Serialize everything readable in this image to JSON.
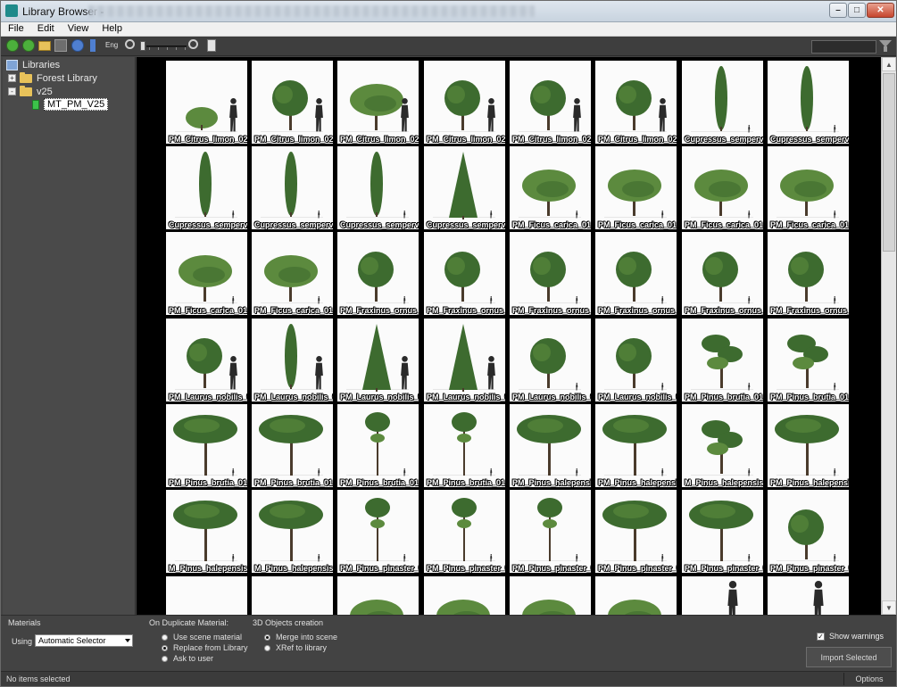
{
  "window": {
    "title": "Library Browser -",
    "icon": "app-icon",
    "controls": [
      "minimize",
      "maximize",
      "close"
    ]
  },
  "menu": [
    "File",
    "Edit",
    "View",
    "Help"
  ],
  "toolbar": {
    "icons": [
      "back-icon",
      "forward-icon",
      "open-folder-icon",
      "save-icon",
      "refresh-icon",
      "sort-icon",
      "zoom-out-icon",
      "zoom-in-icon",
      "checklist-icon"
    ],
    "zoom_slider_label": "thumbnail-size"
  },
  "tree": {
    "items": [
      {
        "label": "Libraries",
        "icon": "library-icon",
        "level": 0,
        "expander": ""
      },
      {
        "label": "Forest Library",
        "icon": "folder-icon",
        "level": 1,
        "expander": "+"
      },
      {
        "label": "v25",
        "icon": "folder-open-icon",
        "level": 1,
        "expander": "-"
      },
      {
        "label": "MT_PM_V25",
        "icon": "material-icon",
        "level": 2,
        "expander": "",
        "selected": true
      }
    ]
  },
  "grid": {
    "rows": [
      [
        "PM_Citrus_limon_02",
        "PM_Citrus_limon_02",
        "PM_Citrus_limon_02",
        "PM_Citrus_limon_02",
        "PM_Citrus_limon_02",
        "PM_Citrus_limon_02",
        "Cupressus_sempervire",
        "Cupressus_sempervire"
      ],
      [
        "Cupressus_sempervire",
        "Cupressus_sempervire",
        "Cupressus_sempervire",
        "Cupressus_sempervire",
        "PM_Ficus_carica_01",
        "PM_Ficus_carica_01",
        "PM_Ficus_carica_01",
        "PM_Ficus_carica_01"
      ],
      [
        "PM_Ficus_carica_01",
        "PM_Ficus_carica_01",
        "PM_Fraxinus_ornus_0",
        "PM_Fraxinus_ornus_0",
        "PM_Fraxinus_ornus_0",
        "PM_Fraxinus_ornus_0",
        "PM_Fraxinus_ornus_0",
        "PM_Fraxinus_ornus_0"
      ],
      [
        "PM_Laurus_nobilis_0",
        "PM_Laurus_nobilis_0",
        "PM_Laurus_nobilis_0",
        "PM_Laurus_nobilis_0",
        "PM_Laurus_nobilis_0",
        "PM_Laurus_nobilis_0",
        "PM_Pinus_brutia_01",
        "PM_Pinus_brutia_01"
      ],
      [
        "PM_Pinus_brutia_01",
        "PM_Pinus_brutia_01",
        "PM_Pinus_brutia_01",
        "PM_Pinus_brutia_01",
        "PM_Pinus_halepensis",
        "PM_Pinus_halepensis",
        "M_Pinus_halepensis",
        "PM_Pinus_halepensis"
      ],
      [
        "M_Pinus_halepensis",
        "M_Pinus_halepensis",
        "PM_Pinus_pinaster_0",
        "PM_Pinus_pinaster_0",
        "PM_Pinus_pinaster_0",
        "PM_Pinus_pinaster_0",
        "PM_Pinus_pinaster_0",
        "PM_Pinus_pinaster_0"
      ],
      [
        "",
        "",
        "",
        "",
        "",
        "",
        "",
        ""
      ]
    ],
    "shapes": [
      [
        "bush",
        "round",
        "wide",
        "round",
        "round",
        "round",
        "columnar",
        "columnar"
      ],
      [
        "columnar",
        "columnar",
        "columnar",
        "conifer",
        "wide",
        "wide",
        "wide",
        "wide"
      ],
      [
        "wide",
        "wide",
        "round",
        "round",
        "round",
        "round",
        "round",
        "round"
      ],
      [
        "round",
        "columnar",
        "conifer",
        "conifer",
        "round",
        "round",
        "pine",
        "pine"
      ],
      [
        "umbrella",
        "umbrella",
        "tallpine",
        "tallpine",
        "umbrella",
        "umbrella",
        "pine",
        "umbrella"
      ],
      [
        "umbrella",
        "umbrella",
        "tallpine",
        "tallpine",
        "tallpine",
        "umbrella",
        "umbrella",
        "round"
      ],
      [
        "bush",
        "bush",
        "wide",
        "wide",
        "wide",
        "wide",
        "person",
        "person"
      ]
    ],
    "people": [
      [
        true,
        true,
        true,
        true,
        true,
        true,
        true,
        true
      ],
      [
        true,
        true,
        true,
        true,
        true,
        true,
        true,
        true
      ],
      [
        true,
        true,
        true,
        true,
        true,
        true,
        true,
        true
      ],
      [
        true,
        true,
        true,
        true,
        true,
        true,
        true,
        true
      ],
      [
        true,
        true,
        true,
        true,
        true,
        true,
        true,
        true
      ],
      [
        true,
        true,
        true,
        true,
        true,
        true,
        true,
        true
      ],
      [
        false,
        false,
        false,
        false,
        false,
        false,
        true,
        true
      ]
    ]
  },
  "bottom": {
    "materials": {
      "title": "Materials",
      "using_label": "Using",
      "using_value": "Automatic Selector"
    },
    "duplicate": {
      "title": "On Duplicate Material:",
      "options": [
        {
          "label": "Use scene material",
          "selected": false
        },
        {
          "label": "Replace from Library",
          "selected": true
        },
        {
          "label": "Ask to user",
          "selected": false
        }
      ]
    },
    "objects": {
      "title": "3D Objects creation",
      "options": [
        {
          "label": "Merge into scene",
          "selected": true
        },
        {
          "label": "XRef to library",
          "selected": false
        }
      ]
    },
    "show_warnings": {
      "label": "Show warnings",
      "checked": true
    },
    "import_button": "Import Selected"
  },
  "status": {
    "text": "No items selected",
    "options_button": "Options"
  },
  "colors": {
    "foliage": "#3d6b2f",
    "foliage_light": "#5c8a3e",
    "trunk": "#4a3b2c",
    "silhouette": "#2a2a2a",
    "tile_bg": "#fbfbfb",
    "accent_green": "#3cc24a"
  }
}
